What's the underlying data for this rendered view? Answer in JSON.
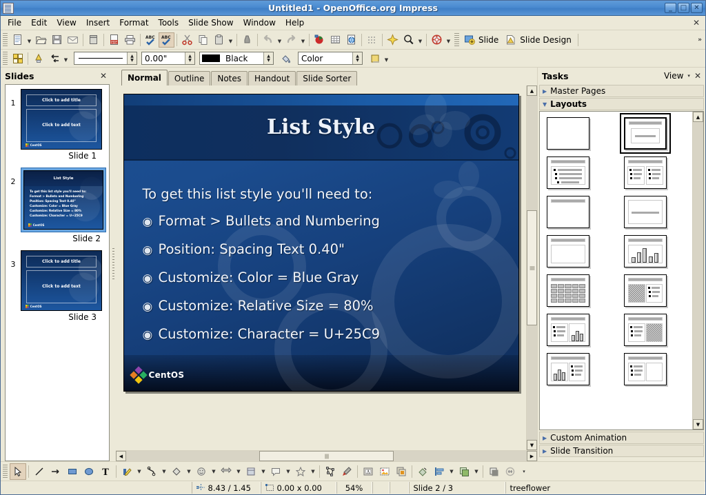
{
  "window": {
    "title": "Untitled1 - OpenOffice.org Impress",
    "app_icon": "impress-document-icon",
    "buttons": {
      "minimize": "_",
      "maximize": "□",
      "close": "✕"
    }
  },
  "menubar": {
    "items": [
      "File",
      "Edit",
      "View",
      "Insert",
      "Format",
      "Tools",
      "Slide Show",
      "Window",
      "Help"
    ],
    "doc_close": "✕"
  },
  "toolbar_standard": {
    "buttons": [
      "new-document-icon",
      "open-document-icon",
      "save-document-icon",
      "email-document-icon",
      "export-pdf-icon",
      "print-icon",
      "spelling-icon",
      "autospellcheck-icon",
      "cut-icon",
      "copy-icon",
      "paste-icon",
      "clone-formatting-icon",
      "undo-icon",
      "redo-icon",
      "chart-icon",
      "table-icon",
      "hyperlink-icon",
      "display-grid-icon",
      "effects-icon",
      "zoom-icon",
      "help-icon"
    ],
    "slide_label": "Slide",
    "slide_design_label": "Slide Design",
    "overflow": "»"
  },
  "toolbar_line_fill": {
    "layout_icon": "slide-layout-icon",
    "lamp_icon": "line-style-lamp-icon",
    "arrow_style_icon": "arrow-style-icon",
    "line_style_value": "",
    "line_width_value": "0.00\"",
    "line_color_value": "Black",
    "bucket_icon": "area-style-bucket-icon",
    "fill_style_value": "Color",
    "fill_color_swatch": "#f0d878"
  },
  "slides_panel": {
    "title": "Slides",
    "close": "✕",
    "slides": [
      {
        "number": "1",
        "label": "Slide 1",
        "selected": false,
        "type": "placeholder",
        "title_text": "Click to add title",
        "outline_text": "Click to add text"
      },
      {
        "number": "2",
        "label": "Slide 2",
        "selected": true,
        "type": "content",
        "title_text": "List Style",
        "lines": [
          "To get this list style you'll need to:",
          "Format > Bullets and Numbering",
          "Position: Spacing Text 0.40\"",
          "Customize: Color = Blue Gray",
          "Customize: Relative Size = 80%",
          "Customize: Character = U+25C9"
        ]
      },
      {
        "number": "3",
        "label": "Slide 3",
        "selected": false,
        "type": "placeholder",
        "title_text": "Click to add title",
        "outline_text": "Click to add text"
      }
    ],
    "logo_text": "CentOS"
  },
  "view_tabs": {
    "tabs": [
      {
        "label": "Normal",
        "active": true
      },
      {
        "label": "Outline",
        "active": false
      },
      {
        "label": "Notes",
        "active": false
      },
      {
        "label": "Handout",
        "active": false
      },
      {
        "label": "Slide Sorter",
        "active": false
      }
    ]
  },
  "slide": {
    "title": "List Style",
    "intro": "To get this list style you'll need to:",
    "bullet_glyph": "◉",
    "bullets": [
      "Format > Bullets and Numbering",
      "Position: Spacing Text 0.40\"",
      "Customize: Color = Blue Gray",
      "Customize: Relative Size = 80%",
      "Customize: Character = U+25C9"
    ],
    "logo_text": "CentOS",
    "colors": {
      "title_text": "#eef3fb",
      "body_text": "#f2f5fa",
      "bg_top": "#1c4f92",
      "bg_bottom": "#0e2c58",
      "title_band": "#0d2f5f"
    }
  },
  "tasks_panel": {
    "title": "Tasks",
    "view_label": "View",
    "view_arrow": "▾",
    "close": "✕",
    "sections": [
      {
        "label": "Master Pages",
        "expanded": false,
        "arrow": "▶"
      },
      {
        "label": "Layouts",
        "expanded": true,
        "arrow": "▼"
      },
      {
        "label": "Custom Animation",
        "expanded": false,
        "arrow": "▶"
      },
      {
        "label": "Slide Transition",
        "expanded": false,
        "arrow": "▶"
      }
    ],
    "layouts": [
      {
        "name": "blank-slide",
        "kind": "blank",
        "selected": false
      },
      {
        "name": "title-content",
        "kind": "title-subtitle",
        "selected": true
      },
      {
        "name": "title-bullets",
        "kind": "title-bullets",
        "selected": false
      },
      {
        "name": "title-two-content",
        "kind": "title-two-bullets",
        "selected": false
      },
      {
        "name": "title-only",
        "kind": "title-only",
        "selected": false
      },
      {
        "name": "centered-text",
        "kind": "centered-text",
        "selected": false
      },
      {
        "name": "title-empty-content",
        "kind": "title-box",
        "selected": false
      },
      {
        "name": "title-chart",
        "kind": "title-chart",
        "selected": false
      },
      {
        "name": "title-table",
        "kind": "title-table",
        "selected": false
      },
      {
        "name": "title-clipart-content",
        "kind": "title-img-bullets",
        "selected": false
      },
      {
        "name": "title-content-chart",
        "kind": "title-bullets-chart",
        "selected": false
      },
      {
        "name": "title-content-clipart",
        "kind": "title-bullets-img",
        "selected": false
      },
      {
        "name": "title-chart-content",
        "kind": "title-chart-bullets",
        "selected": false
      },
      {
        "name": "title-content-object",
        "kind": "title-bullets-box",
        "selected": false
      }
    ]
  },
  "draw_toolbar": {
    "buttons": [
      "select-pointer-icon",
      "line-icon",
      "arrow-line-icon",
      "rectangle-icon",
      "ellipse-icon",
      "text-box-icon",
      "curve-icon",
      "connector-icon",
      "basic-shapes-icon",
      "symbol-shapes-icon",
      "block-arrows-icon",
      "flowchart-icon",
      "callouts-icon",
      "stars-icon",
      "points-icon",
      "glue-points-icon",
      "fontwork-icon",
      "from-file-image-icon",
      "gallery-icon",
      "rotate-icon",
      "alignment-icon",
      "arrange-icon",
      "shadow-icon",
      "crop-icon"
    ],
    "overflow": "▾"
  },
  "statusbar": {
    "cursor_position": "8.43 / 1.45",
    "selection_size": "0.00 x 0.00",
    "zoom": "54%",
    "slide_indicator": "Slide 2 / 3",
    "master_page": "treeflower",
    "position_icon": "cursor-position-icon",
    "size_icon": "object-size-icon"
  }
}
